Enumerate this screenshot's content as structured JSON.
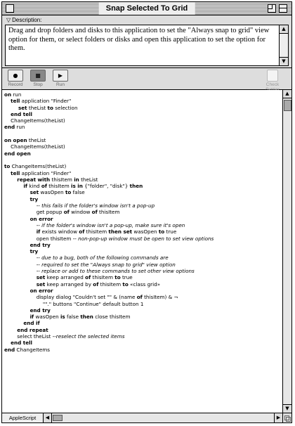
{
  "window": {
    "title": "Snap Selected To Grid"
  },
  "description": {
    "label": "Description:",
    "text": "Drag and drop folders and disks to this application to set the \"Always snap to grid\" view option for them, or select folders or disks and open this application to set the option for them."
  },
  "toolbar": {
    "record_label": "Record",
    "stop_label": "Stop",
    "run_label": "Run",
    "check_syntax_label": "Check Syntax"
  },
  "status": {
    "language": "AppleScript"
  },
  "code": [
    [
      {
        "t": "on",
        "k": 1
      },
      {
        "t": " run"
      }
    ],
    [
      {
        "t": "    "
      },
      {
        "t": "tell",
        "k": 1
      },
      {
        "t": " application \"Finder\""
      }
    ],
    [
      {
        "t": "        set",
        "k": 1
      },
      {
        "t": " theList "
      },
      {
        "t": "to",
        "k": 1
      },
      {
        "t": " selection"
      }
    ],
    [
      {
        "t": "    "
      },
      {
        "t": "end tell",
        "k": 1
      }
    ],
    [
      {
        "t": "    ChangeItems(theList)"
      }
    ],
    [
      {
        "t": "end",
        "k": 1
      },
      {
        "t": " run"
      }
    ],
    [
      {
        "t": ""
      }
    ],
    [
      {
        "t": "on open",
        "k": 1
      },
      {
        "t": " theList"
      }
    ],
    [
      {
        "t": "    ChangeItems(theList)"
      }
    ],
    [
      {
        "t": "end open",
        "k": 1
      }
    ],
    [
      {
        "t": ""
      }
    ],
    [
      {
        "t": "to",
        "k": 1
      },
      {
        "t": " ChangeItems(theList)"
      }
    ],
    [
      {
        "t": "    "
      },
      {
        "t": "tell",
        "k": 1
      },
      {
        "t": " application \"Finder\""
      }
    ],
    [
      {
        "t": "        "
      },
      {
        "t": "repeat with",
        "k": 1
      },
      {
        "t": " thisItem "
      },
      {
        "t": "in",
        "k": 1
      },
      {
        "t": " theList"
      }
    ],
    [
      {
        "t": "            "
      },
      {
        "t": "if",
        "k": 1
      },
      {
        "t": " kind "
      },
      {
        "t": "of",
        "k": 1
      },
      {
        "t": " thisItem "
      },
      {
        "t": "is in",
        "k": 1
      },
      {
        "t": " {\"folder\", \"disk\"} "
      },
      {
        "t": "then",
        "k": 1
      }
    ],
    [
      {
        "t": "                "
      },
      {
        "t": "set",
        "k": 1
      },
      {
        "t": " wasOpen "
      },
      {
        "t": "to",
        "k": 1
      },
      {
        "t": " false"
      }
    ],
    [
      {
        "t": "                "
      },
      {
        "t": "try",
        "k": 1
      }
    ],
    [
      {
        "t": "                    "
      },
      {
        "t": "-- this fails if the folder's window isn't a pop-up",
        "c": 1
      }
    ],
    [
      {
        "t": "                    get popup "
      },
      {
        "t": "of",
        "k": 1
      },
      {
        "t": " window "
      },
      {
        "t": "of",
        "k": 1
      },
      {
        "t": " thisItem"
      }
    ],
    [
      {
        "t": "                "
      },
      {
        "t": "on error",
        "k": 1
      }
    ],
    [
      {
        "t": "                    "
      },
      {
        "t": "-- if the folder's window isn't a pop-up, make sure it's open",
        "c": 1
      }
    ],
    [
      {
        "t": "                    "
      },
      {
        "t": "if",
        "k": 1
      },
      {
        "t": " exists window "
      },
      {
        "t": "of",
        "k": 1
      },
      {
        "t": " thisItem "
      },
      {
        "t": "then set",
        "k": 1
      },
      {
        "t": " wasOpen "
      },
      {
        "t": "to",
        "k": 1
      },
      {
        "t": " true"
      }
    ],
    [
      {
        "t": "                    open thisItem "
      },
      {
        "t": "-- non-pop-up window must be open to set view options",
        "c": 1
      }
    ],
    [
      {
        "t": "                "
      },
      {
        "t": "end try",
        "k": 1
      }
    ],
    [
      {
        "t": "                "
      },
      {
        "t": "try",
        "k": 1
      }
    ],
    [
      {
        "t": "                    "
      },
      {
        "t": "-- due to a bug, both of the following commands are",
        "c": 1
      }
    ],
    [
      {
        "t": "                    "
      },
      {
        "t": "-- required to set the \"Always snap to grid\" view option",
        "c": 1
      }
    ],
    [
      {
        "t": "                    "
      },
      {
        "t": "-- replace or add to these commands to set other view options",
        "c": 1
      }
    ],
    [
      {
        "t": "                    "
      },
      {
        "t": "set",
        "k": 1
      },
      {
        "t": " keep arranged "
      },
      {
        "t": "of",
        "k": 1
      },
      {
        "t": " thisItem "
      },
      {
        "t": "to",
        "k": 1
      },
      {
        "t": " true"
      }
    ],
    [
      {
        "t": "                    "
      },
      {
        "t": "set",
        "k": 1
      },
      {
        "t": " keep arranged by "
      },
      {
        "t": "of",
        "k": 1
      },
      {
        "t": " thisItem "
      },
      {
        "t": "to",
        "k": 1
      },
      {
        "t": " «class grid»"
      }
    ],
    [
      {
        "t": "                "
      },
      {
        "t": "on error",
        "k": 1
      }
    ],
    [
      {
        "t": "                    display dialog \"Couldn't set \"\" & (name "
      },
      {
        "t": "of",
        "k": 1
      },
      {
        "t": " thisItem) & ¬"
      }
    ],
    [
      {
        "t": "                        \"\".\" buttons \"Continue\" default button 1"
      }
    ],
    [
      {
        "t": "                "
      },
      {
        "t": "end try",
        "k": 1
      }
    ],
    [
      {
        "t": "                "
      },
      {
        "t": "if",
        "k": 1
      },
      {
        "t": " wasOpen "
      },
      {
        "t": "is",
        "k": 1
      },
      {
        "t": " false "
      },
      {
        "t": "then",
        "k": 1
      },
      {
        "t": " close thisItem"
      }
    ],
    [
      {
        "t": "            "
      },
      {
        "t": "end if",
        "k": 1
      }
    ],
    [
      {
        "t": "        "
      },
      {
        "t": "end repeat",
        "k": 1
      }
    ],
    [
      {
        "t": "        select theList "
      },
      {
        "t": "--reselect the selected items",
        "c": 1
      }
    ],
    [
      {
        "t": "    "
      },
      {
        "t": "end tell",
        "k": 1
      }
    ],
    [
      {
        "t": "end",
        "k": 1
      },
      {
        "t": " ChangeItems"
      }
    ]
  ]
}
